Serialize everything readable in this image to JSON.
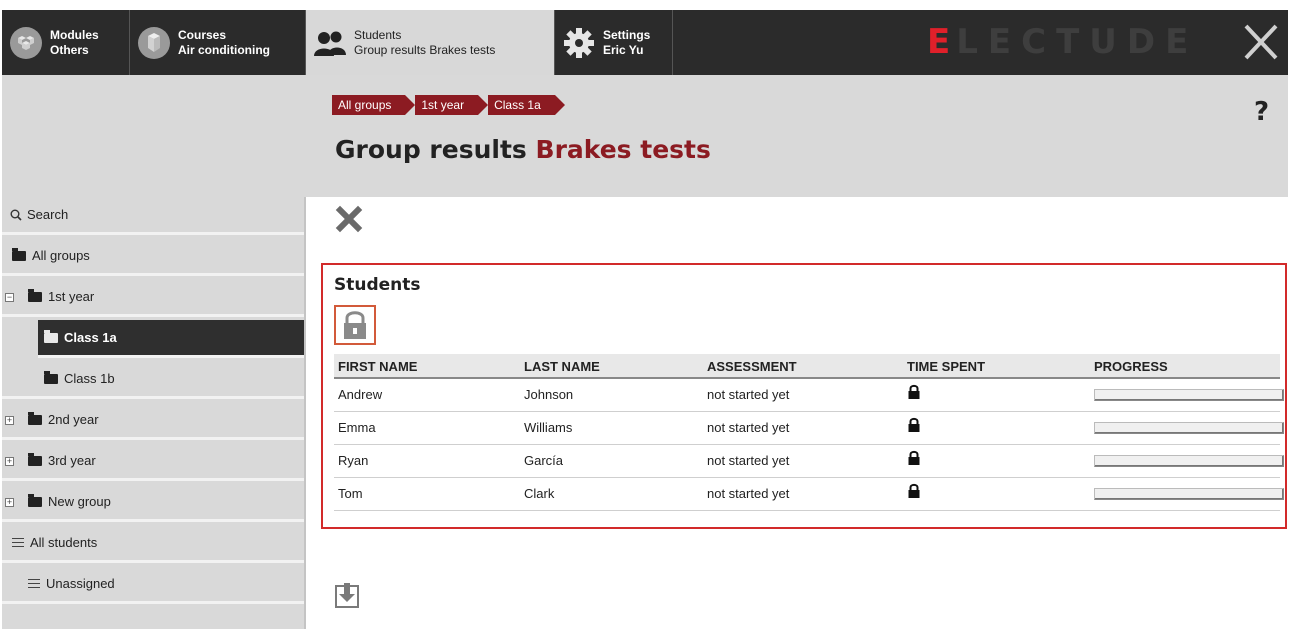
{
  "topnav": {
    "items": [
      {
        "title": "Modules",
        "sub": "Others",
        "icon": "cubes-icon"
      },
      {
        "title": "Courses",
        "sub": "Air conditioning",
        "icon": "cube-stack-icon"
      },
      {
        "title": "Students",
        "sub": "Group results Brakes tests",
        "icon": "students-icon"
      },
      {
        "title": "Settings",
        "sub": "Eric Yu",
        "icon": "gear-icon"
      }
    ],
    "brand_first": "E",
    "brand_rest": "LECTUDE"
  },
  "breadcrumb": [
    "All groups",
    "1st year",
    "Class 1a"
  ],
  "page": {
    "title_prefix": "Group results",
    "title_accent": "Brakes tests",
    "help": "?"
  },
  "sidebar": {
    "search": "Search",
    "items": [
      {
        "label": "All groups"
      },
      {
        "label": "1st year"
      },
      {
        "label": "Class 1a"
      },
      {
        "label": "Class 1b"
      },
      {
        "label": "2nd year"
      },
      {
        "label": "3rd year"
      },
      {
        "label": "New group"
      },
      {
        "label": "All students"
      },
      {
        "label": "Unassigned"
      }
    ]
  },
  "panel": {
    "title": "Students",
    "columns": [
      "FIRST NAME",
      "LAST NAME",
      "ASSESSMENT",
      "TIME SPENT",
      "PROGRESS"
    ],
    "rows": [
      {
        "first": "Andrew",
        "last": "Johnson",
        "assessment": "not started yet",
        "progress": 0
      },
      {
        "first": "Emma",
        "last": "Williams",
        "assessment": "not started yet",
        "progress": 0
      },
      {
        "first": "Ryan",
        "last": "García",
        "assessment": "not started yet",
        "progress": 0
      },
      {
        "first": "Tom",
        "last": "Clark",
        "assessment": "not started yet",
        "progress": 0
      }
    ]
  },
  "colors": {
    "accent": "#8c1b22",
    "highlight_border": "#d22a2a",
    "topbar": "#2b2b2b",
    "brand_red": "#e0202a"
  }
}
